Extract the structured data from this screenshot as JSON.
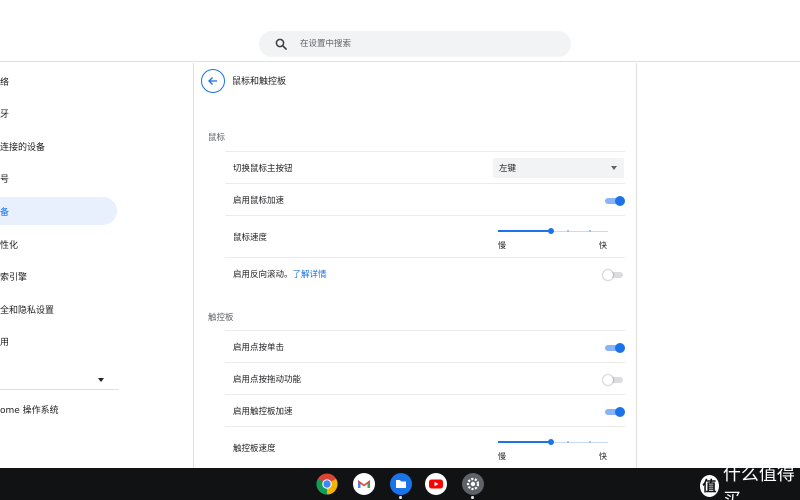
{
  "search": {
    "placeholder": "在设置中搜索",
    "icon": "search-icon"
  },
  "sidebar": {
    "items": [
      {
        "label": "络"
      },
      {
        "label": "牙"
      },
      {
        "label": "连接的设备"
      },
      {
        "label": "号"
      },
      {
        "label": "备",
        "active": true
      },
      {
        "label": "性化"
      },
      {
        "label": "索引擎"
      },
      {
        "label": "全和隐私设置"
      },
      {
        "label": "用"
      }
    ],
    "chrome_os": "ome 操作系统"
  },
  "main": {
    "title": "鼠标和触控板",
    "mouse_section": "鼠标",
    "swap_label": "切换鼠标主按钮",
    "swap_value": "左键",
    "mouse_accel_label": "启用鼠标加速",
    "mouse_accel_on": true,
    "mouse_speed_label": "鼠标速度",
    "mouse_speed_value": 0.48,
    "reverse_label": "启用反向滚动。",
    "reverse_link": "了解详情",
    "reverse_on": false,
    "touchpad_section": "触控板",
    "tap_click_label": "启用点按单击",
    "tap_click_on": true,
    "tap_drag_label": "启用点按拖动功能",
    "tap_drag_on": false,
    "touchpad_accel_label": "启用触控板加速",
    "touchpad_accel_on": true,
    "touchpad_speed_label": "触控板速度",
    "touchpad_speed_value": 0.48,
    "slow": "慢",
    "fast": "快"
  },
  "shelf": {
    "apps": [
      "chrome-icon",
      "gmail-icon",
      "files-icon",
      "youtube-icon",
      "settings-icon"
    ]
  },
  "watermark": {
    "badge": "值",
    "text": "什么值得买"
  },
  "colors": {
    "accent": "#1a73e8",
    "shelf": "#101214"
  }
}
